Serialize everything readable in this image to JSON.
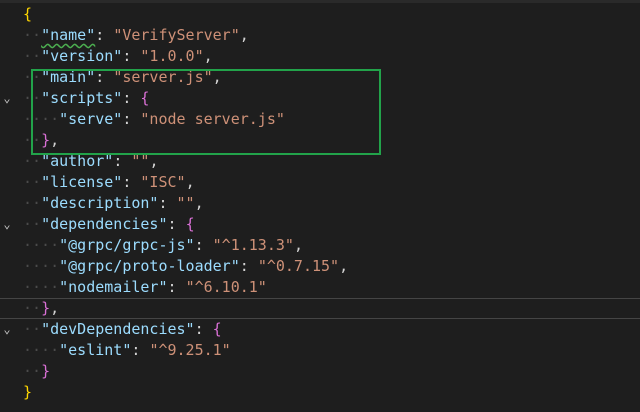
{
  "lines": [
    {
      "segments": [
        {
          "t": "{",
          "c": "brace"
        }
      ],
      "fold": ""
    },
    {
      "segments": [
        {
          "t": "··",
          "c": "dots"
        },
        {
          "t": "\"name\"",
          "c": "key squiggle"
        },
        {
          "t": ": ",
          "c": "punc"
        },
        {
          "t": "\"VerifyServer\"",
          "c": "str"
        },
        {
          "t": ",",
          "c": "punc"
        }
      ],
      "fold": ""
    },
    {
      "segments": [
        {
          "t": "··",
          "c": "dots"
        },
        {
          "t": "\"version\"",
          "c": "key"
        },
        {
          "t": ": ",
          "c": "punc"
        },
        {
          "t": "\"1.0.0\"",
          "c": "str"
        },
        {
          "t": ",",
          "c": "punc"
        }
      ],
      "fold": ""
    },
    {
      "segments": [
        {
          "t": "··",
          "c": "dots"
        },
        {
          "t": "\"main\"",
          "c": "key"
        },
        {
          "t": ": ",
          "c": "punc"
        },
        {
          "t": "\"server.js\"",
          "c": "str"
        },
        {
          "t": ",",
          "c": "punc"
        }
      ],
      "fold": ""
    },
    {
      "segments": [
        {
          "t": "··",
          "c": "dots"
        },
        {
          "t": "\"scripts\"",
          "c": "key"
        },
        {
          "t": ": ",
          "c": "punc"
        },
        {
          "t": "{",
          "c": "brace2"
        }
      ],
      "fold": "⌄"
    },
    {
      "segments": [
        {
          "t": "····",
          "c": "dots"
        },
        {
          "t": "\"serve\"",
          "c": "key"
        },
        {
          "t": ": ",
          "c": "punc"
        },
        {
          "t": "\"node server.js\"",
          "c": "str"
        }
      ],
      "fold": ""
    },
    {
      "segments": [
        {
          "t": "··",
          "c": "dots"
        },
        {
          "t": "}",
          "c": "brace2"
        },
        {
          "t": ",",
          "c": "punc"
        }
      ],
      "fold": ""
    },
    {
      "segments": [
        {
          "t": "··",
          "c": "dots"
        },
        {
          "t": "\"author\"",
          "c": "key"
        },
        {
          "t": ": ",
          "c": "punc"
        },
        {
          "t": "\"\"",
          "c": "str"
        },
        {
          "t": ",",
          "c": "punc"
        }
      ],
      "fold": ""
    },
    {
      "segments": [
        {
          "t": "··",
          "c": "dots"
        },
        {
          "t": "\"license\"",
          "c": "key"
        },
        {
          "t": ": ",
          "c": "punc"
        },
        {
          "t": "\"ISC\"",
          "c": "str"
        },
        {
          "t": ",",
          "c": "punc"
        }
      ],
      "fold": ""
    },
    {
      "segments": [
        {
          "t": "··",
          "c": "dots"
        },
        {
          "t": "\"description\"",
          "c": "key"
        },
        {
          "t": ": ",
          "c": "punc"
        },
        {
          "t": "\"\"",
          "c": "str"
        },
        {
          "t": ",",
          "c": "punc"
        }
      ],
      "fold": ""
    },
    {
      "segments": [
        {
          "t": "··",
          "c": "dots"
        },
        {
          "t": "\"dependencies\"",
          "c": "key"
        },
        {
          "t": ": ",
          "c": "punc"
        },
        {
          "t": "{",
          "c": "brace2"
        }
      ],
      "fold": "⌄"
    },
    {
      "segments": [
        {
          "t": "····",
          "c": "dots"
        },
        {
          "t": "\"@grpc/grpc-js\"",
          "c": "key"
        },
        {
          "t": ": ",
          "c": "punc"
        },
        {
          "t": "\"^1.13.3\"",
          "c": "str"
        },
        {
          "t": ",",
          "c": "punc"
        }
      ],
      "fold": ""
    },
    {
      "segments": [
        {
          "t": "····",
          "c": "dots"
        },
        {
          "t": "\"@grpc/proto-loader\"",
          "c": "key"
        },
        {
          "t": ": ",
          "c": "punc"
        },
        {
          "t": "\"^0.7.15\"",
          "c": "str"
        },
        {
          "t": ",",
          "c": "punc"
        }
      ],
      "fold": ""
    },
    {
      "segments": [
        {
          "t": "····",
          "c": "dots"
        },
        {
          "t": "\"nodemailer\"",
          "c": "key"
        },
        {
          "t": ": ",
          "c": "punc"
        },
        {
          "t": "\"^6.10.1\"",
          "c": "str"
        }
      ],
      "fold": ""
    },
    {
      "segments": [
        {
          "t": "··",
          "c": "dots"
        },
        {
          "t": "}",
          "c": "brace2"
        },
        {
          "t": ",",
          "c": "punc"
        }
      ],
      "fold": "",
      "active": true
    },
    {
      "segments": [
        {
          "t": "··",
          "c": "dots"
        },
        {
          "t": "\"devDependencies\"",
          "c": "key"
        },
        {
          "t": ": ",
          "c": "punc"
        },
        {
          "t": "{",
          "c": "brace2"
        }
      ],
      "fold": "⌄"
    },
    {
      "segments": [
        {
          "t": "····",
          "c": "dots"
        },
        {
          "t": "\"eslint\"",
          "c": "key"
        },
        {
          "t": ": ",
          "c": "punc"
        },
        {
          "t": "\"^9.25.1\"",
          "c": "str"
        }
      ],
      "fold": ""
    },
    {
      "segments": [
        {
          "t": "··",
          "c": "dots"
        },
        {
          "t": "}",
          "c": "brace2"
        }
      ],
      "fold": ""
    },
    {
      "segments": [
        {
          "t": "}",
          "c": "brace"
        }
      ],
      "fold": ""
    }
  ],
  "colors": {
    "background": "#1e1e1e",
    "key": "#9cdcfe",
    "string": "#ce9178",
    "highlight_box": "#22a34a"
  }
}
